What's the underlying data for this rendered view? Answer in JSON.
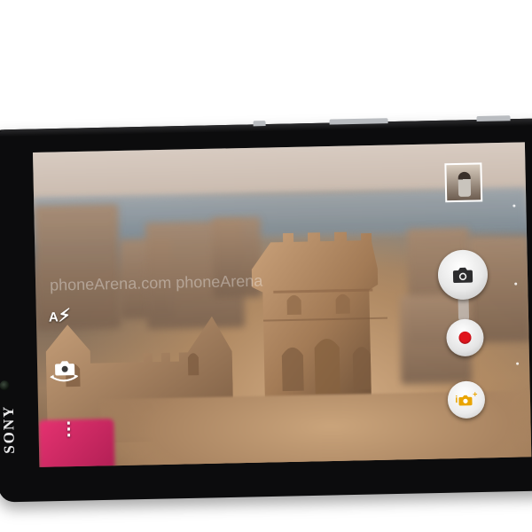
{
  "device": {
    "brand": "SONY"
  },
  "watermark": {
    "text": "phoneArena.com    phoneArena"
  },
  "controls": {
    "flash": {
      "label": "A"
    },
    "more": {
      "glyph": "⋮"
    },
    "apps": {
      "label": "i",
      "plus": "+"
    }
  },
  "colors": {
    "record": "#e0141c",
    "apps_accent": "#e9a400"
  }
}
